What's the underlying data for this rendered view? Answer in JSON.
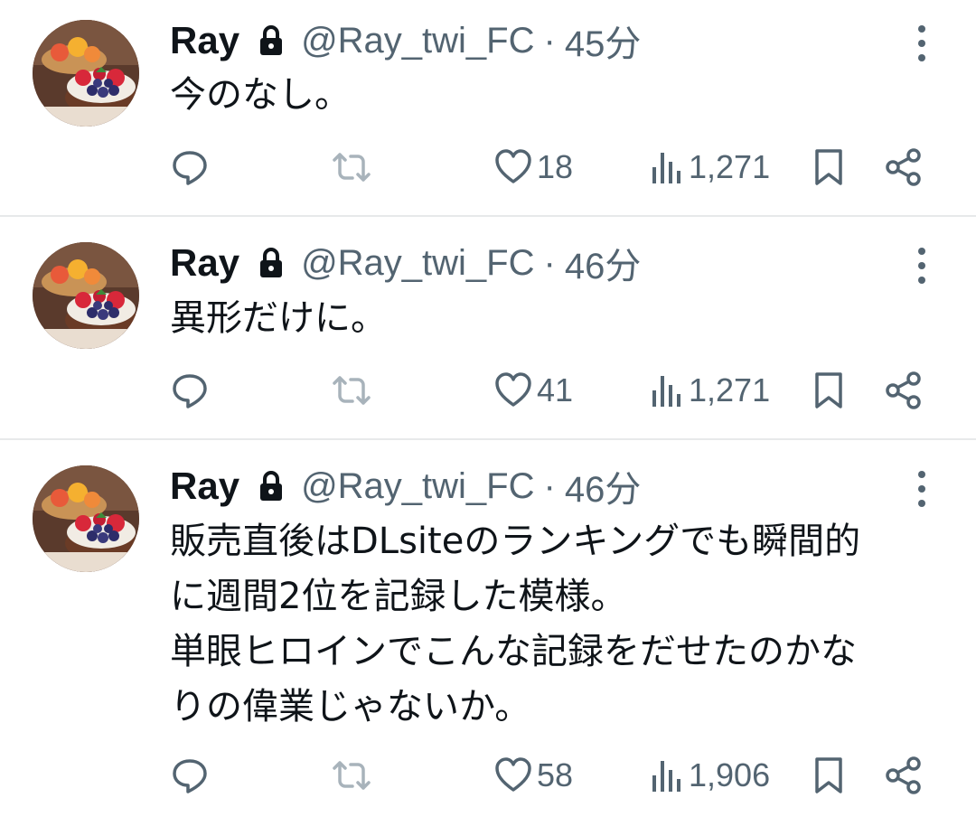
{
  "accent_color": "#536471",
  "tweets": [
    {
      "author": {
        "name": "Ray",
        "handle": "@Ray_twi_FC",
        "protected_icon": "lock-icon",
        "avatar": "fruit-tart-photo"
      },
      "time": "45分",
      "separator": "·",
      "text": "今のなし。",
      "stats": {
        "likes": "18",
        "views": "1,271"
      }
    },
    {
      "author": {
        "name": "Ray",
        "handle": "@Ray_twi_FC",
        "protected_icon": "lock-icon",
        "avatar": "fruit-tart-photo"
      },
      "time": "46分",
      "separator": "·",
      "text": "異形だけに。",
      "stats": {
        "likes": "41",
        "views": "1,271"
      }
    },
    {
      "author": {
        "name": "Ray",
        "handle": "@Ray_twi_FC",
        "protected_icon": "lock-icon",
        "avatar": "fruit-tart-photo"
      },
      "time": "46分",
      "separator": "·",
      "text": "販売直後はDLsiteのランキングでも瞬間的\nに週間2位を記録した模様。\n単眼ヒロインでこんな記録をだせたのかな\nりの偉業じゃないか。",
      "stats": {
        "likes": "58",
        "views": "1,906"
      }
    }
  ],
  "action_icons": [
    "reply-icon",
    "retweet-icon",
    "like-icon",
    "views-icon",
    "bookmark-icon",
    "share-icon"
  ]
}
